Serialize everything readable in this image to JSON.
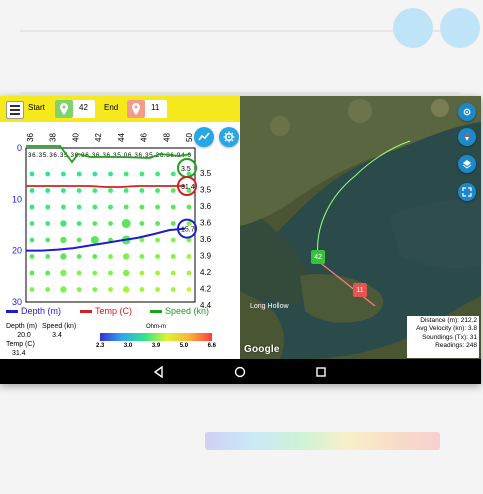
{
  "toolbar": {
    "start_label": "Start",
    "start_value": "42",
    "end_label": "End",
    "end_value": "11"
  },
  "chart_data": {
    "type": "scatter",
    "x_ticks": [
      "36",
      "38",
      "40",
      "42",
      "44",
      "46",
      "48",
      "50"
    ],
    "y_ticks": [
      "0",
      "10",
      "20",
      "30"
    ],
    "speed_labels": [
      "3.5",
      "3.5",
      "3.6",
      "3.6",
      "3.6",
      "3.9",
      "4.2",
      "4.2",
      "4.4"
    ],
    "top_labels": "36.35.36.35.36.36.36.36.35.06.36.35.26.36.94.0",
    "depth_series": {
      "name": "Depth (m)",
      "values": [
        20.0,
        20.0,
        19.8,
        19.5,
        19.0,
        18.5,
        18.0,
        17.5,
        16.8,
        16.0,
        15.7
      ]
    },
    "temp_series": {
      "name": "Temp (C)",
      "values": [
        31.4,
        31.4,
        31.4,
        31.4,
        31.4,
        31.3,
        31.3,
        31.4,
        31.4,
        31.4,
        31.4
      ]
    },
    "speed_series": {
      "name": "Speed (kn)",
      "values": [
        3.4,
        3.5,
        3.5,
        3.5,
        3.5,
        3.5,
        3.5,
        3.4,
        3.4,
        3.5,
        3.5
      ]
    },
    "circle_labels": {
      "speed": "3.5",
      "temp": "31.4",
      "depth": "15.7"
    },
    "ylim": [
      0,
      30
    ]
  },
  "legend": {
    "depth": "Depth (m)",
    "temp": "Temp (C)",
    "speed": "Speed (kn)"
  },
  "readout": {
    "depth_label": "Depth (m)",
    "speed_label": "Speed (kn)",
    "depth_value": "20.0",
    "speed_value": "3.4",
    "temp_label": "Temp (C)",
    "temp_value": "31.4"
  },
  "scale": {
    "title": "Ohm-m",
    "ticks": [
      "2.3",
      "3.0",
      "3.9",
      "5.0",
      "6.6"
    ]
  },
  "map": {
    "start_marker": "42",
    "end_marker": "11",
    "place_label": "Long Hollow",
    "google": "Google"
  },
  "stats": {
    "distance": "Distance (m): 212.2",
    "velocity": "Avg Velocity (kn): 3.8",
    "soundings": "Soundings (Tx): 31",
    "readings": "Readings: 248"
  },
  "colors": {
    "toolbar": "#f6ea1f",
    "depth": "#1d1dcc",
    "temp": "#d32020",
    "speed": "#1aa31a",
    "fab": "#27a7e7"
  }
}
